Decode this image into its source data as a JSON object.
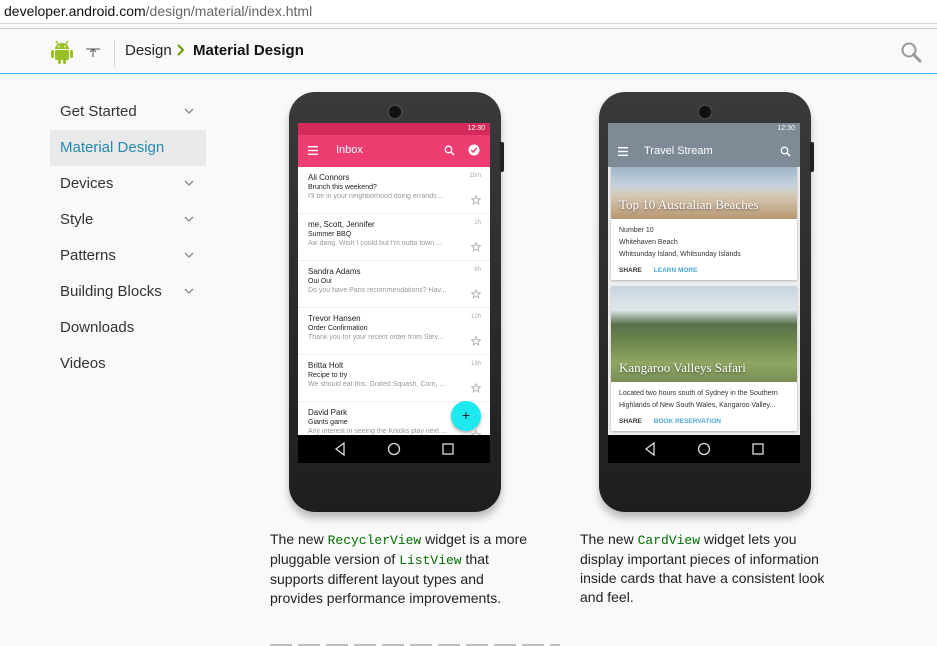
{
  "browser": {
    "url_host": "developer.android.com",
    "url_path": "/design/material/index.html"
  },
  "header": {
    "breadcrumb_parent": "Design",
    "breadcrumb_current": "Material Design"
  },
  "sidebar": {
    "items": [
      {
        "label": "Get Started",
        "expandable": true,
        "active": false
      },
      {
        "label": "Material Design",
        "expandable": false,
        "active": true
      },
      {
        "label": "Devices",
        "expandable": true,
        "active": false
      },
      {
        "label": "Style",
        "expandable": true,
        "active": false
      },
      {
        "label": "Patterns",
        "expandable": true,
        "active": false
      },
      {
        "label": "Building Blocks",
        "expandable": true,
        "active": false
      },
      {
        "label": "Downloads",
        "expandable": false,
        "active": false
      },
      {
        "label": "Videos",
        "expandable": false,
        "active": false
      }
    ]
  },
  "inbox_phone": {
    "status_time": "12:30",
    "title": "Inbox",
    "fab": "+",
    "emails": [
      {
        "sender": "Ali Connors",
        "subject": "Brunch this weekend?",
        "preview": "I'll be in your neighborhood doing errands ...",
        "time": "15m"
      },
      {
        "sender": "me, Scott, Jennifer",
        "subject": "Summer BBQ",
        "preview": "Aw dang. Wish I could but I'm outta town ...",
        "time": "2h"
      },
      {
        "sender": "Sandra Adams",
        "subject": "Oui Oui",
        "preview": "Do you have Paris recommendations? Hav...",
        "time": "6h"
      },
      {
        "sender": "Trevor Hansen",
        "subject": "Order Confirmation",
        "preview": "Thank you for your recent order from Stev...",
        "time": "12h"
      },
      {
        "sender": "Britta Holt",
        "subject": "Recipe to try",
        "preview": "We should eat this: Grated Squash, Corn, ...",
        "time": "18h"
      },
      {
        "sender": "David Park",
        "subject": "Giants game",
        "preview": "Any interest in seeing the Knicks play next ...",
        "time": ""
      }
    ]
  },
  "travel_phone": {
    "status_time": "12:30",
    "title": "Travel Stream",
    "cards": [
      {
        "caption": "Top 10 Australian Beaches",
        "line1": "Number 10",
        "line2": "Whitehaven Beach",
        "line3": "Whitsunday Island, Whitsunday Islands",
        "action1": "SHARE",
        "action2": "LEARN MORE"
      },
      {
        "caption": "Kangaroo Valleys Safari",
        "line1": "Located two hours south of Sydney in the Southern",
        "line2": "Highlands of New South Wales, Kangaroo Valley...",
        "line3": "",
        "action1": "SHARE",
        "action2": "BOOK RESERVATION"
      }
    ]
  },
  "captions": {
    "left": {
      "pre": "The new ",
      "code1": "RecyclerView",
      "mid": " widget is a more pluggable version of ",
      "code2": "ListView",
      "post": " that supports different layout types and provides performance improvements."
    },
    "right": {
      "pre": "The new ",
      "code1": "CardView",
      "post": " widget lets you display important pieces of information inside cards that have a consistent look and feel."
    }
  },
  "colors": {
    "accent": "#33b5e5",
    "active_nav": "#258aaf",
    "inbox_toolbar": "#ee3d71",
    "fab": "#1de9ee",
    "code": "#007000"
  }
}
